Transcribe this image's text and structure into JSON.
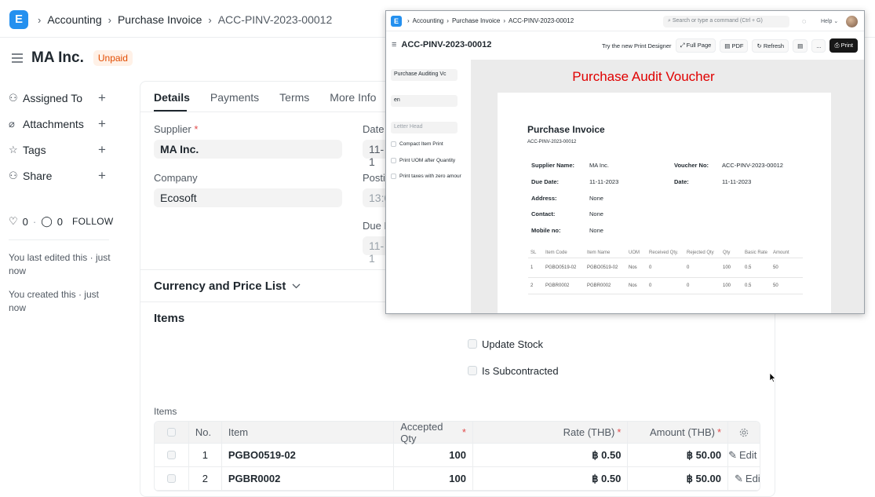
{
  "topbar": {
    "logo": "E",
    "breadcrumbs": [
      "Accounting",
      "Purchase Invoice",
      "ACC-PINV-2023-00012"
    ]
  },
  "page": {
    "title": "MA Inc.",
    "status": "Unpaid",
    "status_color": "#e24c00"
  },
  "sidebar": {
    "items": [
      {
        "label": "Assigned To",
        "icon": "user-plus-icon"
      },
      {
        "label": "Attachments",
        "icon": "paperclip-icon"
      },
      {
        "label": "Tags",
        "icon": "tag-icon"
      },
      {
        "label": "Share",
        "icon": "share-icon"
      }
    ],
    "likes": "0",
    "comments": "0",
    "follow": "FOLLOW",
    "last_edited": "You last edited this · just now",
    "created": "You created this · just now"
  },
  "tabs": [
    "Details",
    "Payments",
    "Terms",
    "More Info",
    "C"
  ],
  "form": {
    "supplier_label": "Supplier",
    "supplier_value": "MA Inc.",
    "company_label": "Company",
    "company_value": "Ecosoft",
    "date_label": "Date",
    "date_value": "11-1",
    "posting_label": "Posti",
    "posting_value": "13:0",
    "due_label": "Due D",
    "due_value": "11-1",
    "currency_section": "Currency and Price List",
    "items_section": "Items",
    "update_stock": "Update Stock",
    "is_subcontracted": "Is Subcontracted",
    "items_table_label": "Items"
  },
  "items_table": {
    "columns": [
      "No.",
      "Item",
      "Accepted Qty",
      "Rate (THB)",
      "Amount (THB)"
    ],
    "rows": [
      {
        "no": "1",
        "item": "PGBO0519-02",
        "qty": "100",
        "rate": "฿ 0.50",
        "amount": "฿ 50.00",
        "edit": "Edit"
      },
      {
        "no": "2",
        "item": "PGBR0002",
        "qty": "100",
        "rate": "฿ 0.50",
        "amount": "฿ 50.00",
        "edit": "Edit"
      }
    ]
  },
  "popup": {
    "logo": "E",
    "breadcrumbs": [
      "Accounting",
      "Purchase Invoice",
      "ACC-PINV-2023-00012"
    ],
    "search_placeholder": "Search or type a command (Ctrl + G)",
    "help": "Help",
    "title": "ACC-PINV-2023-00012",
    "try_designer": "Try the new Print Designer",
    "full_page": "Full Page",
    "pdf": "PDF",
    "refresh": "Refresh",
    "more": "...",
    "print": "Print",
    "print_format": "Purchase Auditing Vc",
    "language": "en",
    "letter_head_placeholder": "Letter Head",
    "options": [
      "Compact Item Print",
      "Print UOM after Quantity",
      "Print taxes with zero amour"
    ],
    "preview_heading": "Purchase Audit Voucher",
    "doc": {
      "title": "Purchase Invoice",
      "subtitle": "ACC-PINV-2023-00012",
      "supplier_name_k": "Supplier Name:",
      "supplier_name_v": "MA Inc.",
      "voucher_no_k": "Voucher No:",
      "voucher_no_v": "ACC-PINV-2023-00012",
      "due_date_k": "Due Date:",
      "due_date_v": "11-11-2023",
      "date_k": "Date:",
      "date_v": "11-11-2023",
      "address_k": "Address:",
      "address_v": "None",
      "contact_k": "Contact:",
      "contact_v": "None",
      "mobile_k": "Mobile no:",
      "mobile_v": "None",
      "table_head": [
        "SL",
        "Item Code",
        "Item Name",
        "UOM",
        "Received Qty.",
        "Rejected Qty",
        "Qty",
        "Basic Rate",
        "Amount"
      ],
      "rows": [
        [
          "1",
          "PGBO0519-02",
          "PGBO0519-02",
          "Nos",
          "0",
          "0",
          "100",
          "0.5",
          "50"
        ],
        [
          "2",
          "PGBR0002",
          "PGBR0002",
          "Nos",
          "0",
          "0",
          "100",
          "0.5",
          "50"
        ]
      ]
    }
  }
}
